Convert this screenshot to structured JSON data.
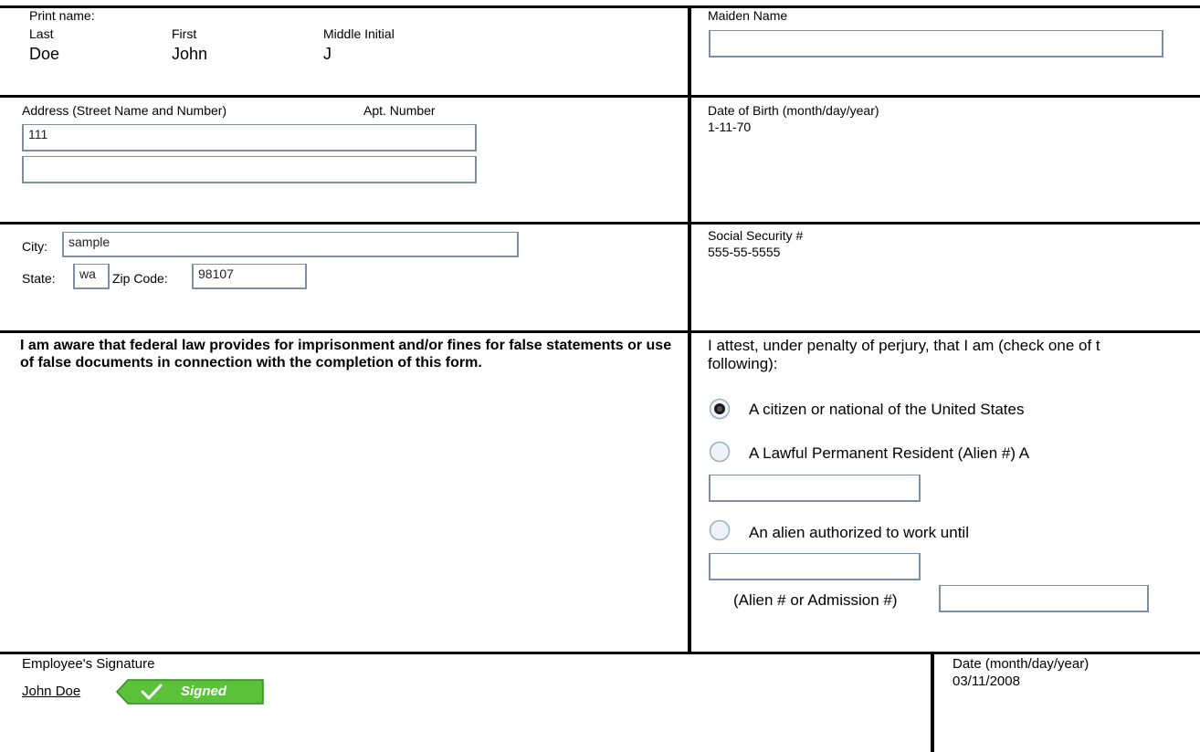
{
  "section1": {
    "print_name_label": "Print name:",
    "last_label": "Last",
    "first_label": "First",
    "middle_label": "Middle Initial",
    "last_value": "Doe",
    "first_value": "John",
    "middle_value": "J",
    "maiden_label": "Maiden Name",
    "maiden_value": ""
  },
  "section2": {
    "address_label": "Address (Street Name and Number)",
    "apt_label": "Apt. Number",
    "address_value": "111",
    "apt_value": "",
    "dob_label": "Date of Birth (month/day/year)",
    "dob_value": "1-11-70"
  },
  "section3": {
    "city_label": "City:",
    "city_value": "sample",
    "state_label": "State:",
    "state_value": "wa",
    "zip_label": "Zip Code:",
    "zip_value": "98107",
    "ssn_label": "Social Security #",
    "ssn_value": "555-55-5555"
  },
  "section4": {
    "warning": "I am aware that federal law provides for imprisonment and/or fines for false statements or use of false documents in connection with the completion of this form.",
    "attest_line1": "I attest, under penalty of perjury, that I am (check one of t",
    "attest_line2": "following):",
    "option_citizen": "A citizen or national of the United States",
    "option_lpr": "A Lawful Permanent Resident (Alien #) A",
    "lpr_value": "",
    "option_alien": "An alien authorized to work until",
    "alien_until_value": "",
    "alien_number_label": "(Alien # or Admission #)",
    "alien_number_value": "",
    "selected_option": "citizen"
  },
  "section5": {
    "signature_label": "Employee's Signature",
    "signature_name": "John Doe",
    "badge_text": "Signed",
    "date_label": "Date (month/day/year)",
    "date_value": "03/11/2008"
  },
  "colors": {
    "field_border": "#7a8fa8",
    "badge_green": "#5cc13a",
    "radio_border": "#9aaec4"
  }
}
